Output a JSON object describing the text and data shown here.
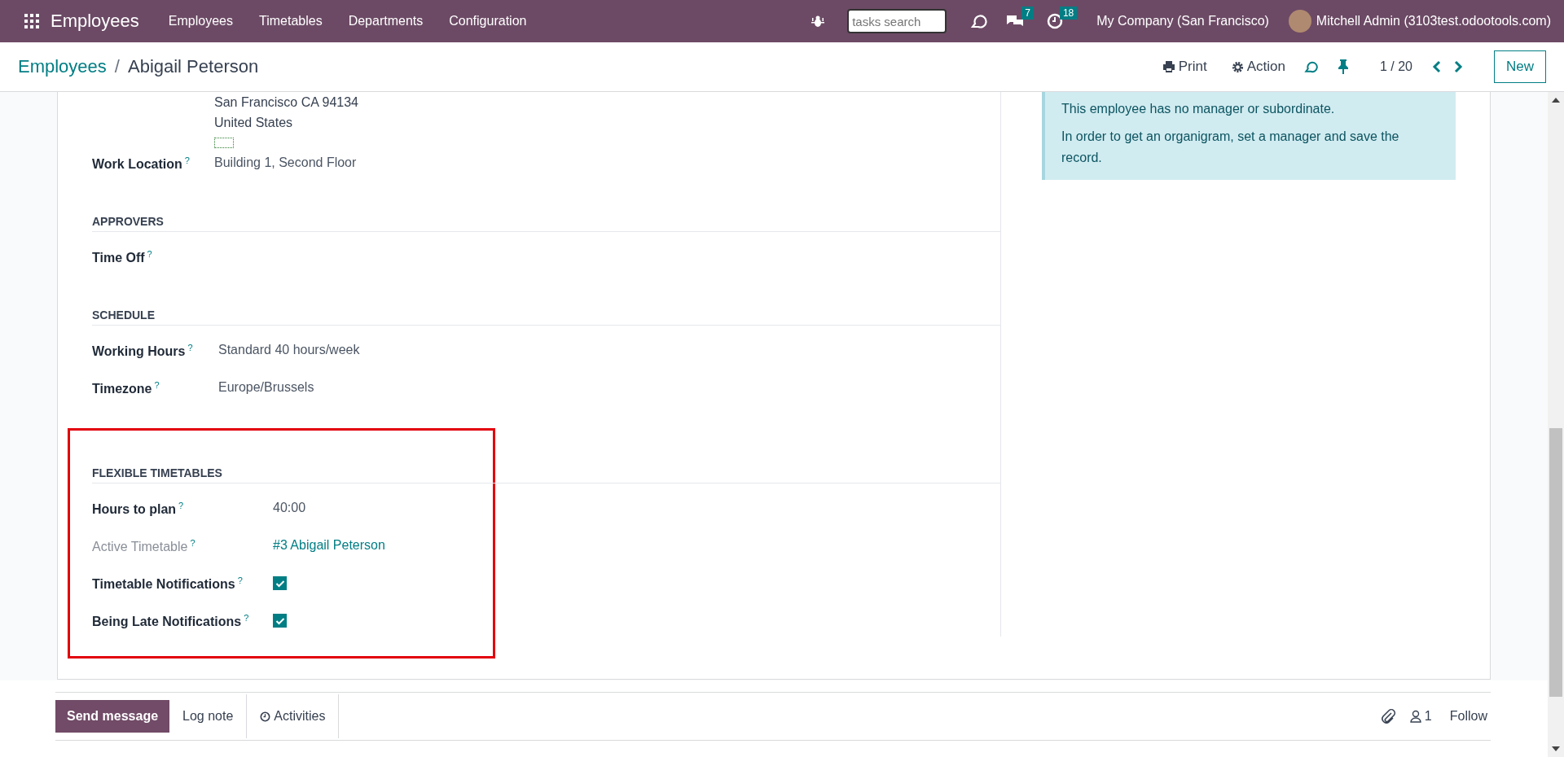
{
  "navbar": {
    "app_name": "Employees",
    "menu": [
      "Employees",
      "Timetables",
      "Departments",
      "Configuration"
    ],
    "search": {
      "placeholder": "tasks search"
    },
    "messages_count": "7",
    "activities_count": "18",
    "company": "My Company (San Francisco)",
    "user": "Mitchell Admin (3103test.odootools.com)"
  },
  "breadcrumb": {
    "parent": "Employees",
    "separator": "/",
    "current": "Abigail Peterson"
  },
  "actions": {
    "print": "Print",
    "action": "Action",
    "pager": "1 / 20",
    "new": "New"
  },
  "address": [
    "San Francisco CA 94134",
    "United States"
  ],
  "sections": [
    {
      "highlighted": false,
      "fields": [
        {
          "label": "Work Location",
          "help": "?",
          "kind": "text",
          "value": "Building 1, Second Floor",
          "muted": false
        }
      ]
    },
    {
      "title": "APPROVERS",
      "highlighted": false,
      "fields": [
        {
          "label": "Time Off",
          "help": "?",
          "kind": "text",
          "muted": false
        }
      ]
    },
    {
      "title": "SCHEDULE",
      "highlighted": false,
      "fields": [
        {
          "label": "Working Hours",
          "help": "?",
          "kind": "text",
          "value": "Standard 40 hours/week",
          "muted": false
        },
        {
          "label": "Timezone",
          "help": "?",
          "kind": "text",
          "value": "Europe/Brussels",
          "muted": false
        }
      ]
    },
    {
      "title": "FLEXIBLE TIMETABLES",
      "highlighted": true,
      "fields": [
        {
          "label": "Hours to plan",
          "help": "?",
          "kind": "text",
          "value": "40:00",
          "muted": false
        },
        {
          "label": "Active Timetable",
          "help": "?",
          "kind": "link",
          "value": "#3 Abigail Peterson",
          "muted": true
        },
        {
          "label": "Timetable Notifications",
          "help": "?",
          "kind": "checkbox",
          "checked": true,
          "muted": false
        },
        {
          "label": "Being Late Notifications",
          "help": "?",
          "kind": "checkbox",
          "checked": true,
          "muted": false
        }
      ]
    }
  ],
  "info_box": [
    "This employee has no manager or subordinate.",
    "In order to get an organigram, set a manager and save the record."
  ],
  "chatter": {
    "send": "Send message",
    "log": "Log note",
    "activities": "Activities",
    "followers": "1",
    "follow": "Follow"
  }
}
